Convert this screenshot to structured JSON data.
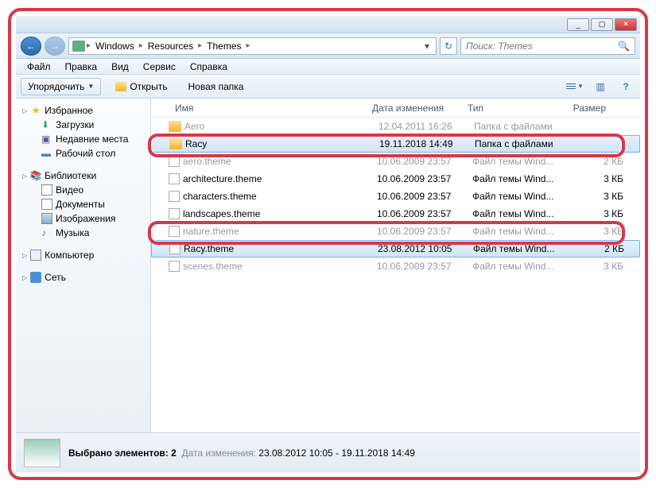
{
  "titlebar": {
    "min": "_",
    "max": "▢",
    "close": "✕"
  },
  "nav": {
    "back": "←",
    "fwd": "→",
    "crumbs": [
      "Windows",
      "Resources",
      "Themes"
    ],
    "refresh": "↻",
    "search_placeholder": "Поиск: Themes",
    "search_icon": "🔍"
  },
  "menu": [
    "Файл",
    "Правка",
    "Вид",
    "Сервис",
    "Справка"
  ],
  "toolbar": {
    "organize": "Упорядочить",
    "open": "Открыть",
    "newfolder": "Новая папка",
    "help": "?"
  },
  "sidebar": {
    "favorites": {
      "label": "Избранное",
      "items": [
        "Загрузки",
        "Недавние места",
        "Рабочий стол"
      ]
    },
    "libraries": {
      "label": "Библиотеки",
      "items": [
        "Видео",
        "Документы",
        "Изображения",
        "Музыка"
      ]
    },
    "computer": "Компьютер",
    "network": "Сеть"
  },
  "columns": {
    "name": "Имя",
    "date": "Дата изменения",
    "type": "Тип",
    "size": "Размер"
  },
  "rows": [
    {
      "name": "Aero",
      "date": "12.04.2011 16:26",
      "type": "Папка с файлами",
      "size": "",
      "icon": "folder",
      "sel": false,
      "dim": true
    },
    {
      "name": "Racy",
      "date": "19.11.2018 14:49",
      "type": "Папка с файлами",
      "size": "",
      "icon": "folder",
      "sel": true
    },
    {
      "name": "aero.theme",
      "date": "10.06.2009 23:57",
      "type": "Файл темы Wind...",
      "size": "2 КБ",
      "icon": "file",
      "dim": true
    },
    {
      "name": "architecture.theme",
      "date": "10.06.2009 23:57",
      "type": "Файл темы Wind...",
      "size": "3 КБ",
      "icon": "file"
    },
    {
      "name": "characters.theme",
      "date": "10.06.2009 23:57",
      "type": "Файл темы Wind...",
      "size": "3 КБ",
      "icon": "file"
    },
    {
      "name": "landscapes.theme",
      "date": "10.06.2009 23:57",
      "type": "Файл темы Wind...",
      "size": "3 КБ",
      "icon": "file"
    },
    {
      "name": "nature.theme",
      "date": "10.06.2009 23:57",
      "type": "Файл темы Wind...",
      "size": "3 КБ",
      "icon": "file",
      "dim": true
    },
    {
      "name": "Racy.theme",
      "date": "23.08.2012 10:05",
      "type": "Файл темы Wind...",
      "size": "2 КБ",
      "icon": "file",
      "sel": true
    },
    {
      "name": "scenes.theme",
      "date": "10.06.2009 23:57",
      "type": "Файл темы Wind...",
      "size": "3 КБ",
      "icon": "file",
      "dim": true
    }
  ],
  "status": {
    "selected": "Выбрано элементов: 2",
    "date_label": "Дата изменения:",
    "date_value": "23.08.2012 10:05 - 19.11.2018 14:49"
  }
}
